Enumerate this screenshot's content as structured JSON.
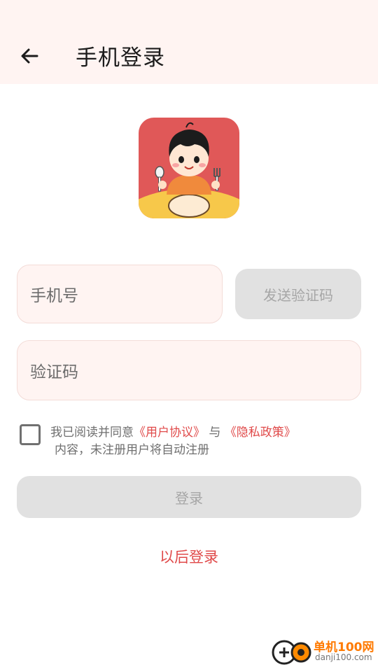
{
  "header": {
    "title": "手机登录",
    "back_icon": "arrow-left-icon",
    "background": "#fff4f2"
  },
  "logo": {
    "icon": "child-eating-app-logo",
    "background": "#e05858"
  },
  "form": {
    "phone_placeholder": "手机号",
    "send_code_label": "发送验证码",
    "code_placeholder": "验证码",
    "agreement": {
      "prefix": "我已阅读并同意",
      "user_agreement": "《用户协议》",
      "and": "与",
      "privacy_policy": "《隐私政策》",
      "suffix": "内容，未注册用户将自动注册"
    },
    "login_label": "登录",
    "later_label": "以后登录"
  },
  "watermark": {
    "name": "单机100网",
    "domain": "danji100.com"
  },
  "colors": {
    "accent": "#e04a4a",
    "field_bg": "#fff4f2",
    "disabled_button": "#e1e1e1",
    "disabled_text": "#a6a6a6"
  }
}
